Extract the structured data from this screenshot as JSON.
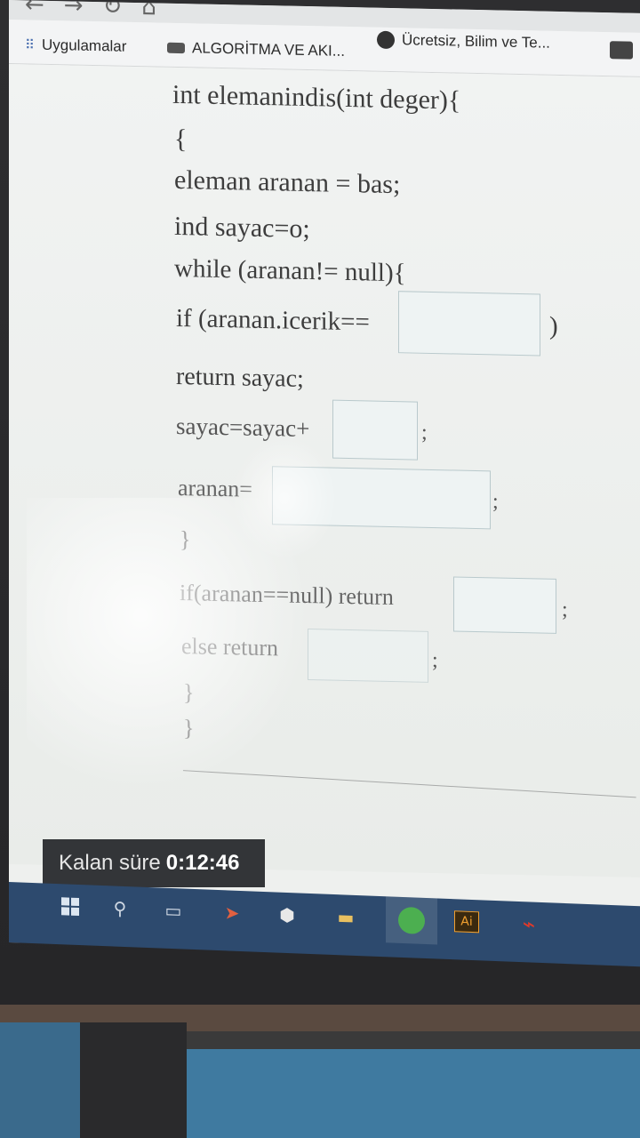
{
  "browser": {
    "bookmarks": [
      {
        "label": "Uygulamalar",
        "icon": "apps-grid-icon"
      },
      {
        "label": "ALGORİTMA VE AKI...",
        "icon": "youtube-icon"
      },
      {
        "label": "Ücretsiz, Bilim ve Te...",
        "icon": "globe-icon"
      }
    ]
  },
  "code": {
    "line1": "int elemanindis(int deger){",
    "line2": "{",
    "line3": "eleman aranan = bas;",
    "line4": "ind sayac=o;",
    "line5": "while (aranan!= null){",
    "line6_prefix": "if (aranan.icerik==",
    "line6_suffix": ")",
    "line7": "return sayac;",
    "line8_prefix": "sayac=sayac+",
    "line8_suffix": ";",
    "line9_prefix": "aranan=",
    "line9_suffix": ";",
    "line10": "}",
    "line11_prefix": "if(aranan==null) return",
    "line11_suffix": ";",
    "line12_prefix": "else return",
    "line12_suffix": ";",
    "line13": "}",
    "line14": "}"
  },
  "timer": {
    "label": "Kalan süre",
    "value": "0:12:46"
  },
  "taskbar": {
    "items": [
      "windows-start-icon",
      "search-icon",
      "task-view-icon",
      "app-icon",
      "shield-icon",
      "file-explorer-icon",
      "chrome-icon",
      "illustrator-icon",
      "pdf-icon"
    ],
    "illustrator_label": "Ai"
  }
}
